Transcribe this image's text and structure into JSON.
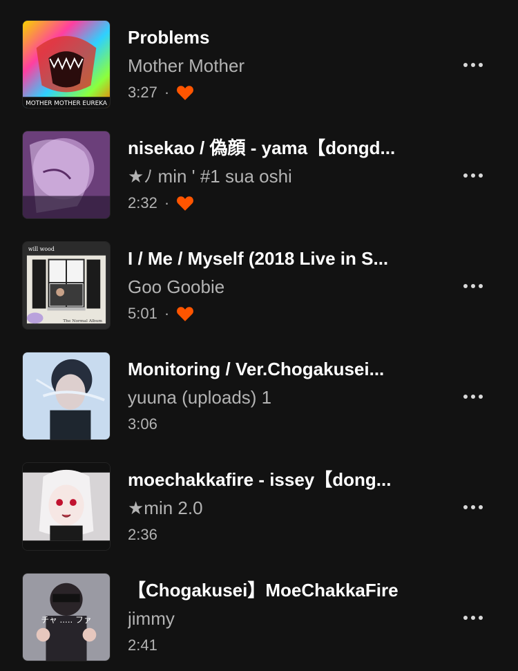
{
  "colors": {
    "background": "#121212",
    "liked": "#ff5500",
    "secondary_text": "#b3b3b3"
  },
  "tracks": [
    {
      "title": "Problems",
      "artist": "Mother Mother",
      "duration": "3:27",
      "liked": true,
      "art_text": "MOTHER MOTHER EUREKA"
    },
    {
      "title": "nisekao / 偽顔 - yama【dongd...",
      "artist": "★ﾉ min ' #1 sua oshi",
      "duration": "2:32",
      "liked": true
    },
    {
      "title": "I / Me / Myself (2018 Live in S...",
      "artist": "Goo Goobie",
      "duration": "5:01",
      "liked": true,
      "art_text": "will wood",
      "art_text2": "The Normal Album"
    },
    {
      "title": "Monitoring / Ver.Chogakusei...",
      "artist": "yuuna (uploads) 1",
      "duration": "3:06",
      "liked": false
    },
    {
      "title": "moechakkafire - issey【dong...",
      "artist": "★min 2.0",
      "duration": "2:36",
      "liked": false
    },
    {
      "title": "【Chogakusei】MoeChakkaFire",
      "artist": "jimmy",
      "duration": "2:41",
      "liked": false,
      "art_text": "チャ ..... ファ"
    }
  ],
  "separator": "·",
  "icons": {
    "heart": "heart-icon",
    "more": "more-options-icon"
  }
}
